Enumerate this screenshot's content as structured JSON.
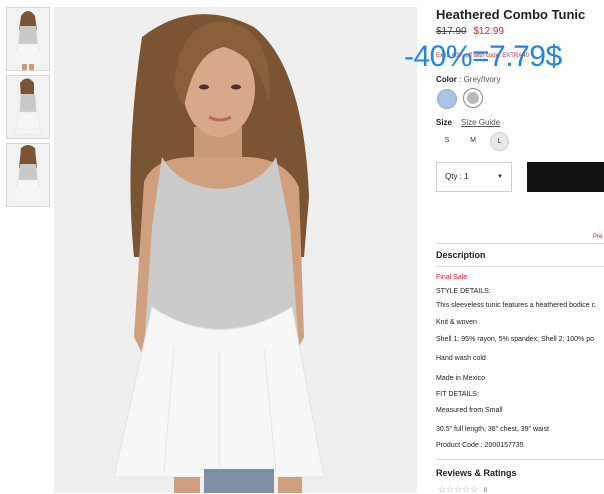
{
  "product": {
    "title": "Heathered Combo Tunic",
    "price_old": "$17.90",
    "price_new": "$12.99",
    "promo_text": "Extra 40% off with code: EXTRA40",
    "discount_overlay": "-40%=7.79$"
  },
  "color": {
    "label": "Color",
    "value": ": Grey/Ivory",
    "swatches": [
      "light-blue",
      "grey"
    ]
  },
  "size": {
    "label": "Size",
    "guide_link": "Size Guide",
    "options": [
      "S",
      "M",
      "L"
    ],
    "selected": "L"
  },
  "qty": {
    "label": "Qty : 1",
    "caret": "▼"
  },
  "wishlist_text": "Pre",
  "description": {
    "heading": "Description",
    "final_sale": "Final Sale",
    "style_details_h": "STYLE DETAILS:",
    "style_text": "This sleeveless tunic features a heathered bodice c",
    "fabric": "Knit & woven",
    "content": "Shell 1: 95% rayon, 5% spandex; Shell 2: 100% po",
    "care": "Hand wash cold",
    "origin": "Made in Mexico",
    "fit_details_h": "FIT DETAILS:",
    "fit_size": "Measured from Small",
    "measurements": "30.5\" full length, 36\" chest, 39\" waist",
    "product_code": "Product Code : 2000157735"
  },
  "reviews": {
    "heading": "Reviews & Ratings",
    "stars": "☆☆☆☆☆",
    "count": "0"
  },
  "colors": {
    "red": "#d0262e",
    "blue_overlay": "#1f86e8",
    "button_black": "#111111"
  }
}
